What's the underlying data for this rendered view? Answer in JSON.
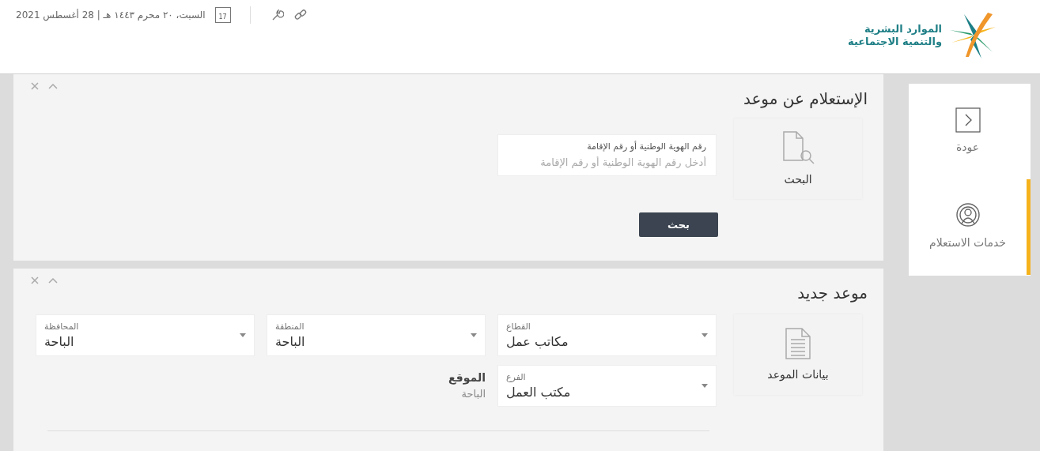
{
  "header": {
    "logo": {
      "line1": "الموارد البشرية",
      "line2": "والتنمية الاجتماعية"
    },
    "date": "السبت، ٢٠ محرم ١٤٤٣ هـ | 28 أغسطس 2021",
    "calendar_day": "17"
  },
  "sidebar": {
    "items": [
      {
        "label": "عودة",
        "kind": "back",
        "selected": false
      },
      {
        "label": "خدمات الاستعلام",
        "kind": "inquiry",
        "selected": true
      }
    ]
  },
  "panels": [
    {
      "title": "الإستعلام عن موعد",
      "card": {
        "label": "البحث",
        "kind": "search"
      },
      "field": {
        "label": "رقم الهوية الوطنية أو رقم الإقامة",
        "placeholder": "أدخل رقم الهوية الوطنية أو رقم الإقامة"
      },
      "button": "بحث"
    },
    {
      "title": "موعد جديد",
      "card": {
        "label": "بيانات الموعد",
        "kind": "document"
      },
      "selects": [
        {
          "label": "القطاع",
          "value": "مكاتب عمل"
        },
        {
          "label": "المنطقة",
          "value": "الباحة"
        },
        {
          "label": "المحافظة",
          "value": "الباحة"
        },
        {
          "label": "الفرع",
          "value": "مكتب العمل"
        }
      ],
      "location": {
        "label": "الموقع",
        "value": "الباحة"
      }
    }
  ]
}
